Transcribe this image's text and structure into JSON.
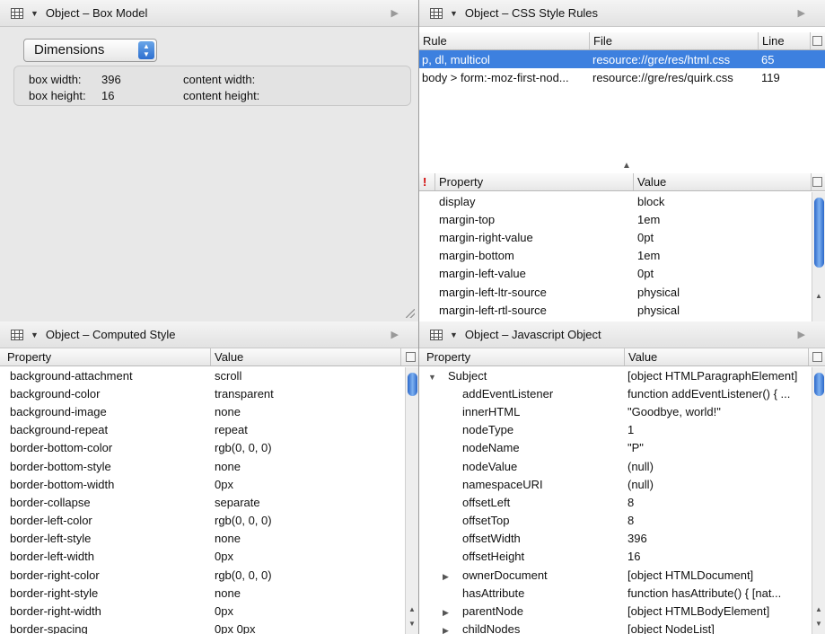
{
  "box_model": {
    "title": "Object – Box Model",
    "dropdown": "Dimensions",
    "box_width_label": "box width:",
    "box_width_value": "396",
    "box_height_label": "box height:",
    "box_height_value": "16",
    "content_width_label": "content width:",
    "content_height_label": "content height:"
  },
  "css_rules": {
    "title": "Object – CSS Style Rules",
    "columns": [
      "Rule",
      "File",
      "Line"
    ],
    "rules": [
      {
        "rule": "p, dl, multicol",
        "file": "resource://gre/res/html.css",
        "line": "65",
        "selected": true
      },
      {
        "rule": "body > form:-moz-first-nod...",
        "file": "resource://gre/res/quirk.css",
        "line": "119",
        "selected": false
      }
    ],
    "prop_columns": [
      "!",
      "Property",
      "Value"
    ],
    "properties": [
      {
        "name": "display",
        "value": "block"
      },
      {
        "name": "margin-top",
        "value": "1em"
      },
      {
        "name": "margin-right-value",
        "value": "0pt"
      },
      {
        "name": "margin-bottom",
        "value": "1em"
      },
      {
        "name": "margin-left-value",
        "value": "0pt"
      },
      {
        "name": "margin-left-ltr-source",
        "value": "physical"
      },
      {
        "name": "margin-left-rtl-source",
        "value": "physical"
      }
    ]
  },
  "computed_style": {
    "title": "Object – Computed Style",
    "columns": [
      "Property",
      "Value"
    ],
    "rows": [
      {
        "name": "background-attachment",
        "value": "scroll"
      },
      {
        "name": "background-color",
        "value": "transparent"
      },
      {
        "name": "background-image",
        "value": "none"
      },
      {
        "name": "background-repeat",
        "value": "repeat"
      },
      {
        "name": "border-bottom-color",
        "value": "rgb(0, 0, 0)"
      },
      {
        "name": "border-bottom-style",
        "value": "none"
      },
      {
        "name": "border-bottom-width",
        "value": "0px"
      },
      {
        "name": "border-collapse",
        "value": "separate"
      },
      {
        "name": "border-left-color",
        "value": "rgb(0, 0, 0)"
      },
      {
        "name": "border-left-style",
        "value": "none"
      },
      {
        "name": "border-left-width",
        "value": "0px"
      },
      {
        "name": "border-right-color",
        "value": "rgb(0, 0, 0)"
      },
      {
        "name": "border-right-style",
        "value": "none"
      },
      {
        "name": "border-right-width",
        "value": "0px"
      },
      {
        "name": "border-spacing",
        "value": "0px 0px"
      }
    ]
  },
  "js_object": {
    "title": "Object – Javascript Object",
    "columns": [
      "Property",
      "Value"
    ],
    "rows": [
      {
        "name": "Subject",
        "value": "[object HTMLParagraphElement]",
        "expander": "▼",
        "depth": 0
      },
      {
        "name": "addEventListener",
        "value": "function addEventListener() {   ...",
        "expander": "",
        "depth": 1
      },
      {
        "name": "innerHTML",
        "value": "\"Goodbye, world!\"",
        "expander": "",
        "depth": 1
      },
      {
        "name": "nodeType",
        "value": "1",
        "expander": "",
        "depth": 1
      },
      {
        "name": "nodeName",
        "value": "\"P\"",
        "expander": "",
        "depth": 1
      },
      {
        "name": "nodeValue",
        "value": "(null)",
        "expander": "",
        "depth": 1
      },
      {
        "name": "namespaceURI",
        "value": "(null)",
        "expander": "",
        "depth": 1
      },
      {
        "name": "offsetLeft",
        "value": "8",
        "expander": "",
        "depth": 1
      },
      {
        "name": "offsetTop",
        "value": "8",
        "expander": "",
        "depth": 1
      },
      {
        "name": "offsetWidth",
        "value": "396",
        "expander": "",
        "depth": 1
      },
      {
        "name": "offsetHeight",
        "value": "16",
        "expander": "",
        "depth": 1
      },
      {
        "name": "ownerDocument",
        "value": "[object HTMLDocument]",
        "expander": "▶",
        "depth": 1
      },
      {
        "name": "hasAttribute",
        "value": "function hasAttribute() {    [nat...",
        "expander": "",
        "depth": 1
      },
      {
        "name": "parentNode",
        "value": "[object HTMLBodyElement]",
        "expander": "▶",
        "depth": 1
      },
      {
        "name": "childNodes",
        "value": "[object NodeList]",
        "expander": "▶",
        "depth": 1
      }
    ]
  }
}
